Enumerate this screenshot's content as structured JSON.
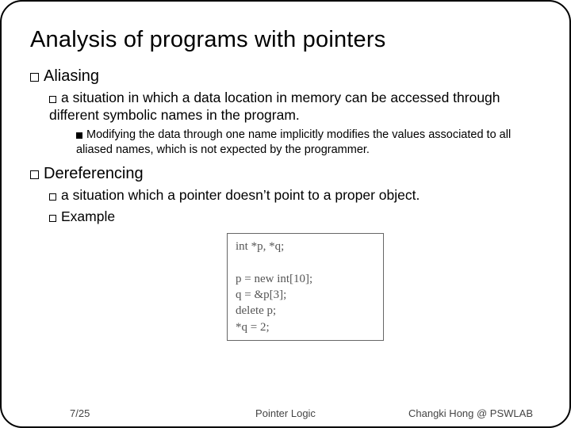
{
  "title": "Analysis of programs with pointers",
  "sections": [
    {
      "heading": "Aliasing",
      "items": [
        {
          "text": "a situation in which a data location in memory can be accessed through different symbolic names in the program.",
          "sub": [
            {
              "text": "Modifying the data through one name implicitly modifies the values associated to all aliased names,  which is not expected by the programmer."
            }
          ]
        }
      ]
    },
    {
      "heading": "Dereferencing",
      "items": [
        {
          "text": "a situation which a pointer doesn’t point to a proper object."
        },
        {
          "text": "Example"
        }
      ]
    }
  ],
  "code": "int *p, *q;\n\np = new int[10];\nq = &p[3];\ndelete p;\n*q = 2;",
  "footer": {
    "left": "7/25",
    "center": "Pointer Logic",
    "right": "Changki Hong @ PSWLAB"
  }
}
